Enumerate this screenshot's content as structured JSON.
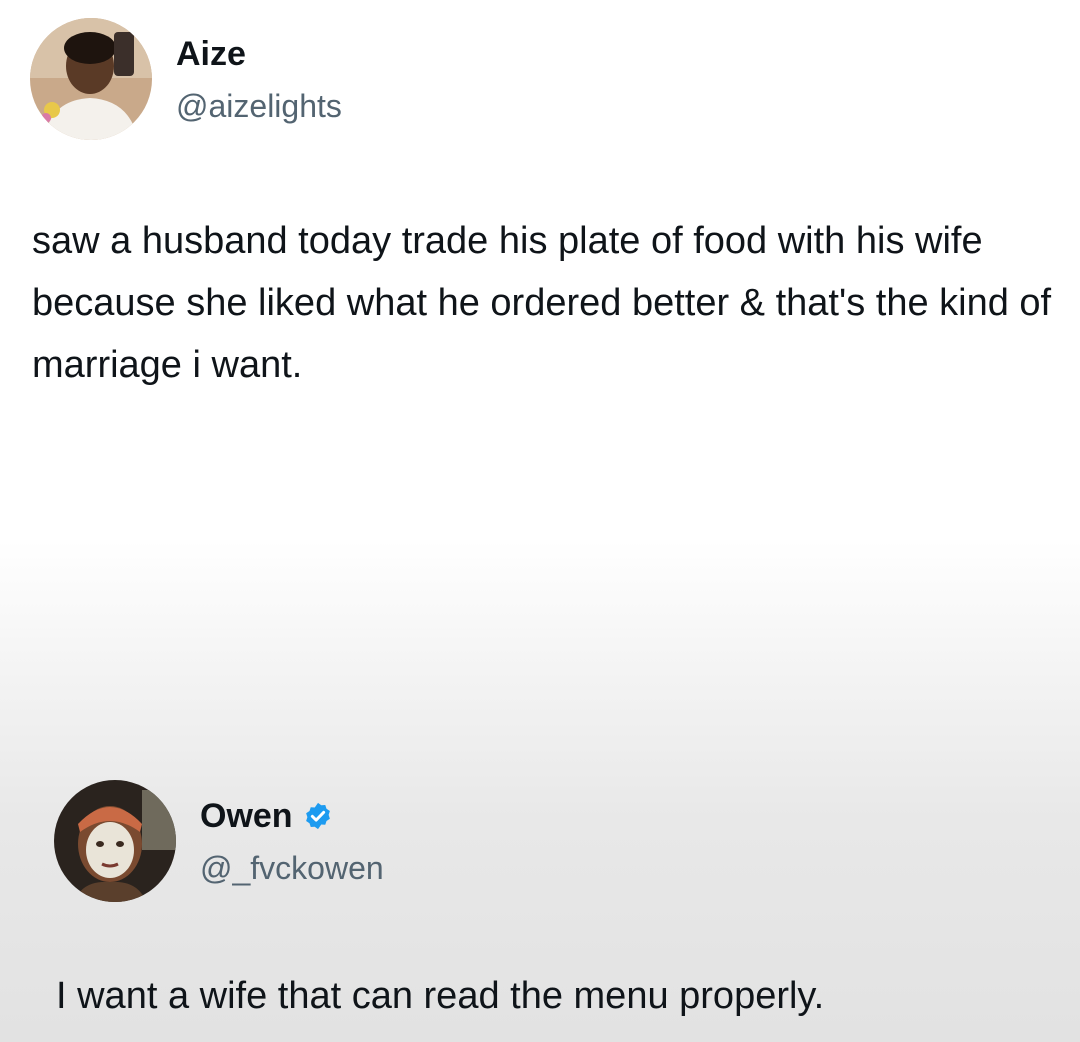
{
  "tweets": [
    {
      "author": {
        "name": "Aize",
        "handle": "@aizelights",
        "verified": false
      },
      "text": "saw a husband today trade his plate of food with his wife because she liked what he ordered better & that's the kind of marriage i want."
    },
    {
      "author": {
        "name": "Owen",
        "handle": "@_fvckowen",
        "verified": true
      },
      "text": "I want a wife that can read the menu properly."
    }
  ],
  "colors": {
    "text": "#0f1419",
    "handle": "#536471",
    "verified": "#1d9bf0"
  }
}
